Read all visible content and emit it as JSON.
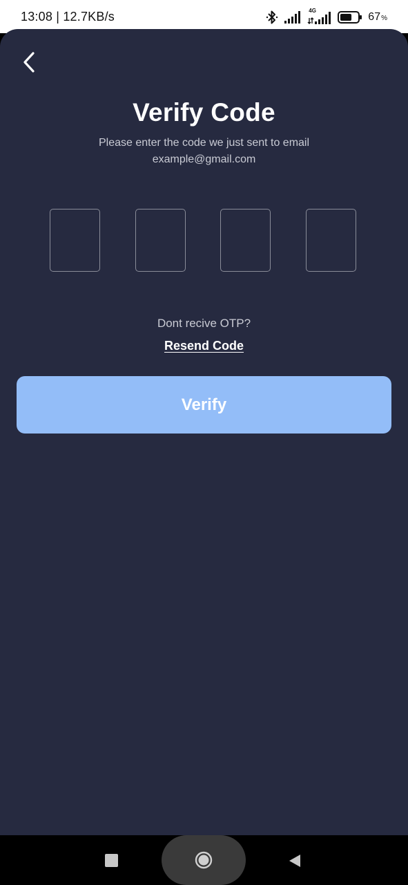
{
  "status_bar": {
    "time_speed": "13:08 | 12.7KB/s",
    "network_label": "4G",
    "battery_percent": "67",
    "battery_percent_sign": "%",
    "battery_level": 0.67
  },
  "header": {
    "title": "Verify Code",
    "subtitle_line1": "Please enter the code we just sent to email",
    "subtitle_line2": "example@gmail.com"
  },
  "otp": {
    "digits": [
      "",
      "",
      "",
      ""
    ]
  },
  "resend": {
    "prompt": "Dont recive OTP?",
    "link_label": "Resend Code"
  },
  "actions": {
    "verify_label": "Verify"
  },
  "colors": {
    "background": "#262a40",
    "accent": "#93bdf8",
    "text_primary": "#ffffff",
    "text_secondary": "#c9cbd4",
    "otp_border": "#8a8d99"
  },
  "icons": {
    "back": "chevron-left-icon",
    "bluetooth": "bluetooth-icon",
    "signal": "signal-icon",
    "battery": "battery-icon",
    "nav_recents": "square-icon",
    "nav_home": "circle-icon",
    "nav_back": "triangle-left-icon"
  }
}
